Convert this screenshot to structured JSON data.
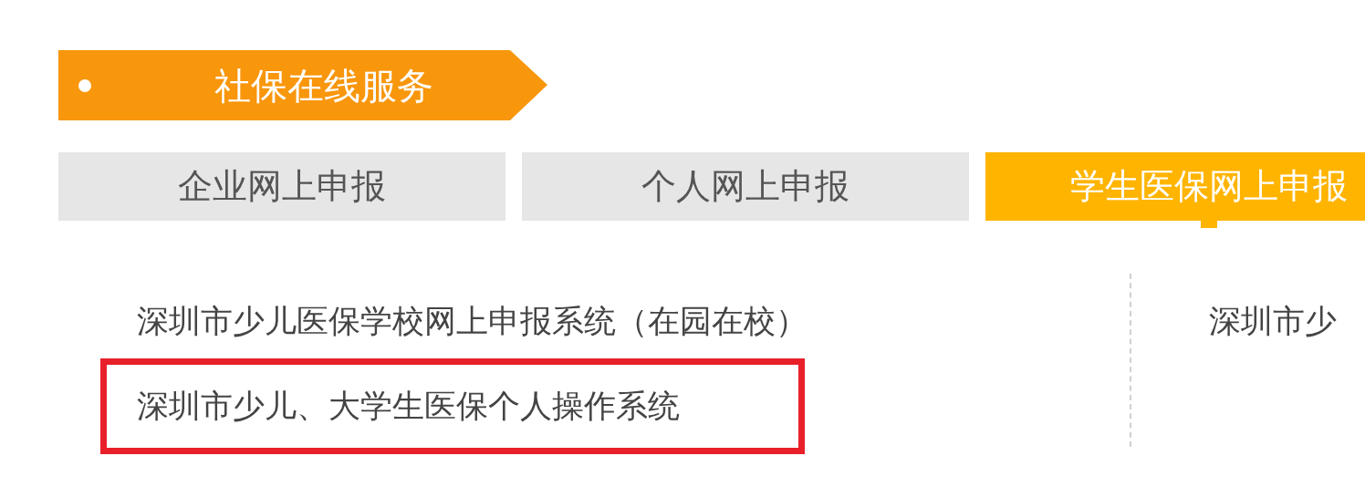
{
  "header": {
    "title": "社保在线服务"
  },
  "tabs": [
    {
      "label": "企业网上申报",
      "selected": false
    },
    {
      "label": "个人网上申报",
      "selected": false
    },
    {
      "label": "学生医保网上申报",
      "selected": true
    }
  ],
  "links": [
    {
      "text": "深圳市少儿医保学校网上申报系统（在园在校）",
      "highlighted": false
    },
    {
      "text": "深圳市少儿、大学生医保个人操作系统",
      "highlighted": true
    }
  ],
  "right_links": [
    {
      "text": "深圳市少"
    }
  ]
}
